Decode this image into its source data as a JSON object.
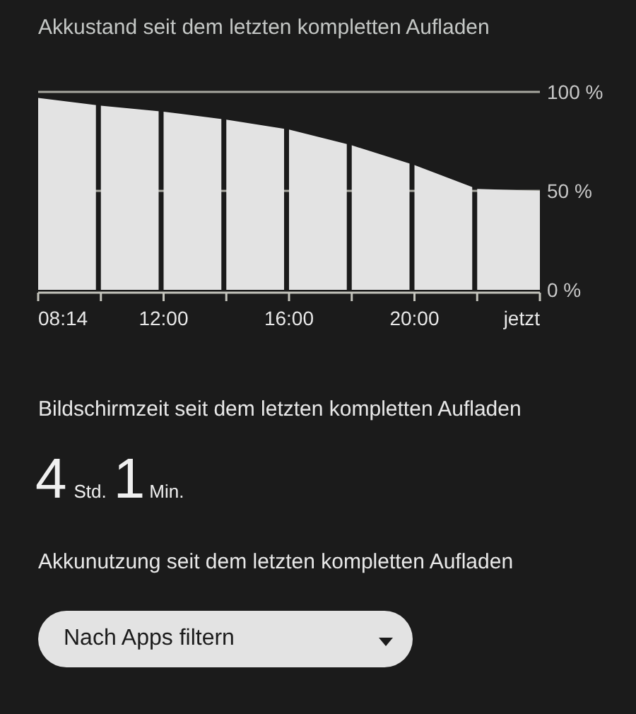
{
  "battery_section": {
    "title": "Akkustand seit dem letzten kompletten Aufladen",
    "chart_data": {
      "type": "area",
      "categories": [
        "08:14",
        null,
        "12:00",
        null,
        "16:00",
        null,
        "20:00",
        null,
        "jetzt"
      ],
      "series": [
        {
          "color": "#e3e3e3",
          "values": [
            97,
            93,
            90,
            86,
            81,
            73,
            63,
            51,
            50
          ]
        }
      ],
      "ylim": [
        0,
        100
      ],
      "yticks": [
        {
          "value": 0,
          "label": "0 %"
        },
        {
          "value": 50,
          "label": "50 %"
        },
        {
          "value": 100,
          "label": "100 %"
        }
      ]
    }
  },
  "screen_time": {
    "title": "Bildschirmzeit seit dem letzten kompletten Aufladen",
    "hours": "4",
    "hours_unit": "Std.",
    "minutes": "1",
    "minutes_unit": "Min."
  },
  "usage": {
    "title": "Akkunutzung seit dem letzten kompletten Aufladen",
    "filter_dropdown": "Nach Apps filtern"
  }
}
